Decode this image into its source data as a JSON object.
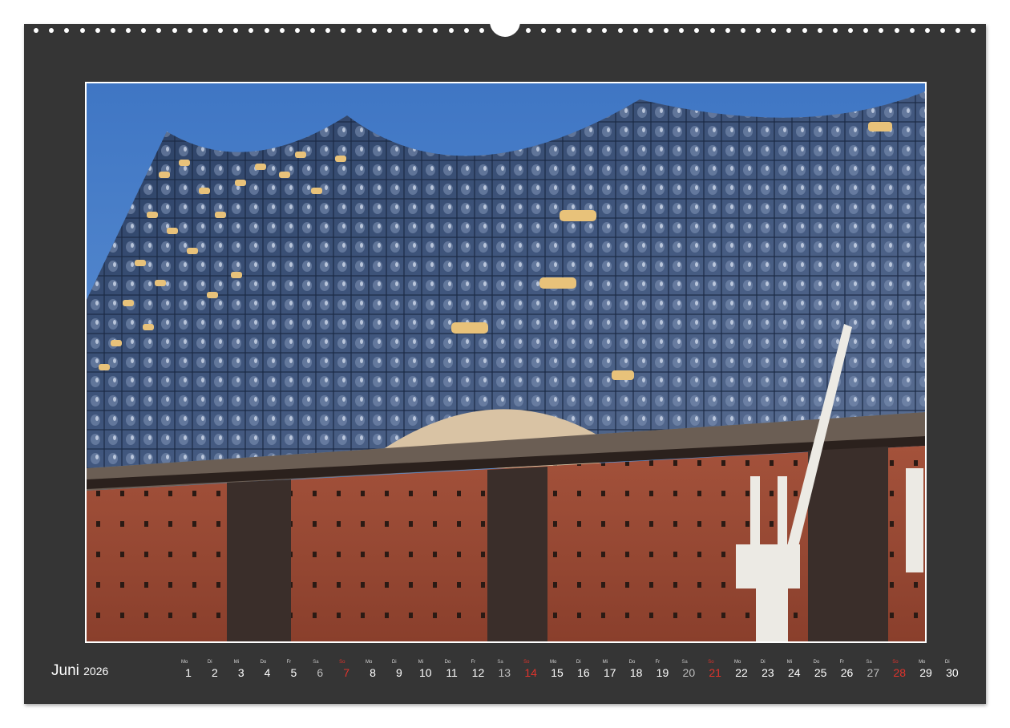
{
  "calendar": {
    "month": "Juni",
    "year": "2026",
    "days": [
      {
        "dow": "Mo",
        "num": "1",
        "type": "weekday"
      },
      {
        "dow": "Di",
        "num": "2",
        "type": "weekday"
      },
      {
        "dow": "Mi",
        "num": "3",
        "type": "weekday"
      },
      {
        "dow": "Do",
        "num": "4",
        "type": "weekday"
      },
      {
        "dow": "Fr",
        "num": "5",
        "type": "weekday"
      },
      {
        "dow": "Sa",
        "num": "6",
        "type": "sat"
      },
      {
        "dow": "So",
        "num": "7",
        "type": "sun"
      },
      {
        "dow": "Mo",
        "num": "8",
        "type": "weekday"
      },
      {
        "dow": "Di",
        "num": "9",
        "type": "weekday"
      },
      {
        "dow": "Mi",
        "num": "10",
        "type": "weekday"
      },
      {
        "dow": "Do",
        "num": "11",
        "type": "weekday"
      },
      {
        "dow": "Fr",
        "num": "12",
        "type": "weekday"
      },
      {
        "dow": "Sa",
        "num": "13",
        "type": "sat"
      },
      {
        "dow": "So",
        "num": "14",
        "type": "sun"
      },
      {
        "dow": "Mo",
        "num": "15",
        "type": "weekday"
      },
      {
        "dow": "Di",
        "num": "16",
        "type": "weekday"
      },
      {
        "dow": "Mi",
        "num": "17",
        "type": "weekday"
      },
      {
        "dow": "Do",
        "num": "18",
        "type": "weekday"
      },
      {
        "dow": "Fr",
        "num": "19",
        "type": "weekday"
      },
      {
        "dow": "Sa",
        "num": "20",
        "type": "sat"
      },
      {
        "dow": "So",
        "num": "21",
        "type": "sun"
      },
      {
        "dow": "Mo",
        "num": "22",
        "type": "weekday"
      },
      {
        "dow": "Di",
        "num": "23",
        "type": "weekday"
      },
      {
        "dow": "Mi",
        "num": "24",
        "type": "weekday"
      },
      {
        "dow": "Do",
        "num": "25",
        "type": "weekday"
      },
      {
        "dow": "Fr",
        "num": "26",
        "type": "weekday"
      },
      {
        "dow": "Sa",
        "num": "27",
        "type": "sat"
      },
      {
        "dow": "So",
        "num": "28",
        "type": "sun"
      },
      {
        "dow": "Mo",
        "num": "29",
        "type": "weekday"
      },
      {
        "dow": "Di",
        "num": "30",
        "type": "weekday"
      }
    ]
  },
  "colors": {
    "page": "#353535",
    "sunday": "#e0332c",
    "sky": "#4a7fc9",
    "brick": "#9a4a35"
  },
  "photo": {
    "subject": "photo-elbphilharmonie"
  }
}
